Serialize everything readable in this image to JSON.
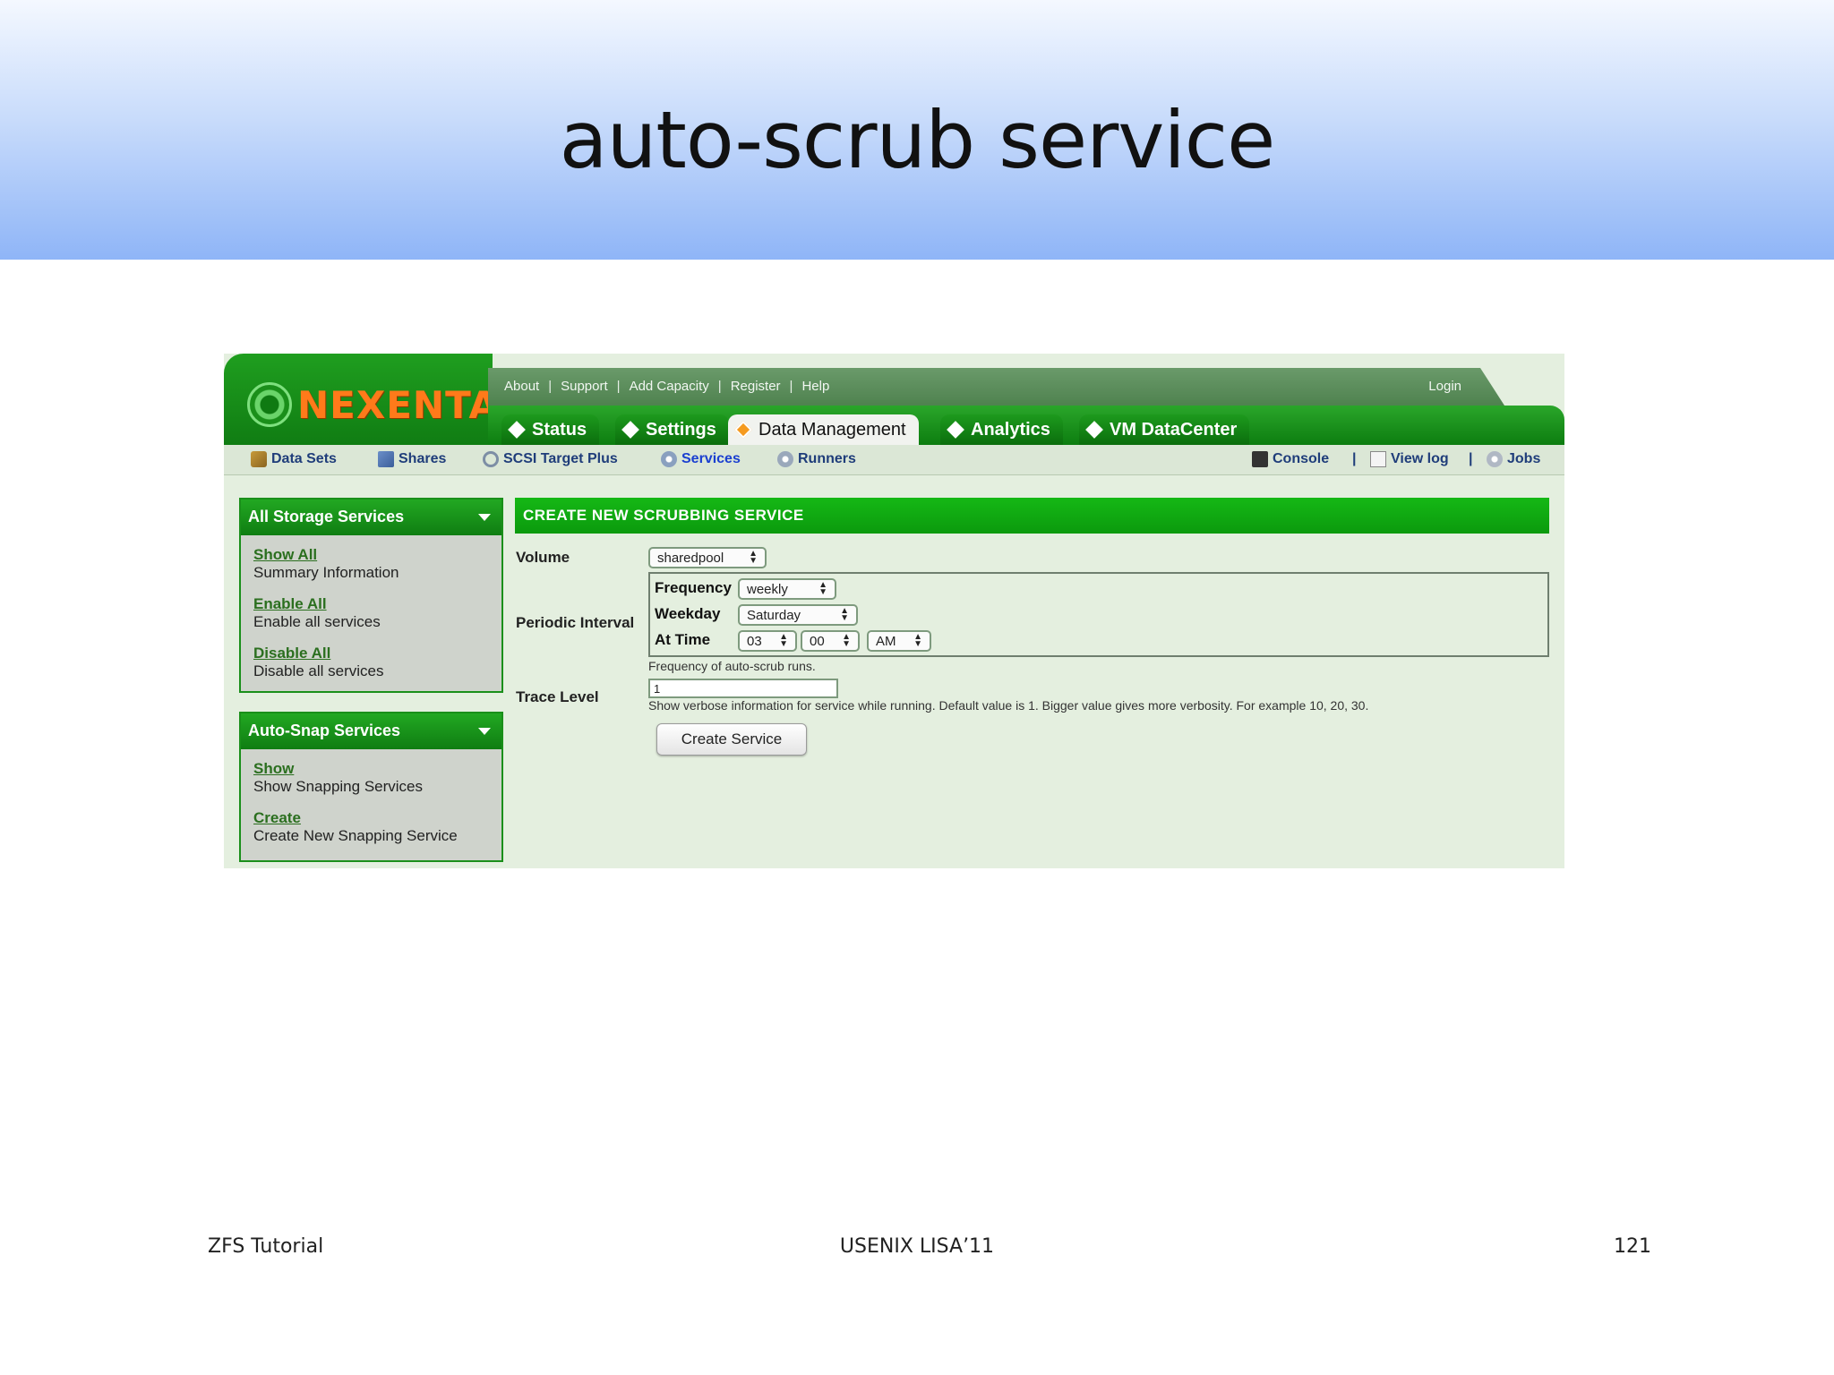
{
  "slide": {
    "title": "auto-scrub service",
    "footer_left": "ZFS Tutorial",
    "footer_center": "USENIX LISA’11",
    "footer_right": "121"
  },
  "app": {
    "logo_text": "NEXENTA",
    "top_nav": [
      "About",
      "Support",
      "Add Capacity",
      "Register",
      "Help"
    ],
    "login": "Login",
    "tabs": [
      {
        "label": "Status",
        "active": false
      },
      {
        "label": "Settings",
        "active": false
      },
      {
        "label": "Data Management",
        "active": true
      },
      {
        "label": "Analytics",
        "active": false
      },
      {
        "label": "VM DataCenter",
        "active": false
      }
    ],
    "subnav_left": [
      {
        "label": "Data Sets",
        "icon": "datasets-icon"
      },
      {
        "label": "Shares",
        "icon": "shares-icon"
      },
      {
        "label": "SCSI Target Plus",
        "icon": "scsi-icon"
      },
      {
        "label": "Services",
        "icon": "services-icon",
        "active": true
      },
      {
        "label": "Runners",
        "icon": "runners-icon"
      }
    ],
    "subnav_right": [
      {
        "label": "Console",
        "icon": "console-icon"
      },
      {
        "label": "View log",
        "icon": "log-icon"
      },
      {
        "label": "Jobs",
        "icon": "jobs-icon"
      }
    ],
    "sidebar": {
      "storage": {
        "title": "All Storage Services",
        "items": [
          {
            "link": "Show All",
            "desc": "Summary Information"
          },
          {
            "link": "Enable All",
            "desc": "Enable all services"
          },
          {
            "link": "Disable All",
            "desc": "Disable all services"
          }
        ]
      },
      "autosnap": {
        "title": "Auto-Snap Services",
        "items": [
          {
            "link": "Show",
            "desc": "Show Snapping Services"
          },
          {
            "link": "Create",
            "desc": "Create New Snapping Service"
          }
        ]
      }
    },
    "form": {
      "header": "CREATE NEW SCRUBBING SERVICE",
      "volume_label": "Volume",
      "volume_value": "sharedpool",
      "periodic_label": "Periodic Interval",
      "frequency_label": "Frequency",
      "frequency_value": "weekly",
      "weekday_label": "Weekday",
      "weekday_value": "Saturday",
      "attime_label": "At Time",
      "hour_value": "03",
      "minute_value": "00",
      "ampm_value": "AM",
      "frequency_help": "Frequency of auto-scrub runs.",
      "trace_label": "Trace Level",
      "trace_value": "1",
      "trace_help": "Show verbose information for service while running. Default value is 1. Bigger value gives more verbosity. For example 10, 20, 30.",
      "submit_label": "Create Service"
    }
  }
}
